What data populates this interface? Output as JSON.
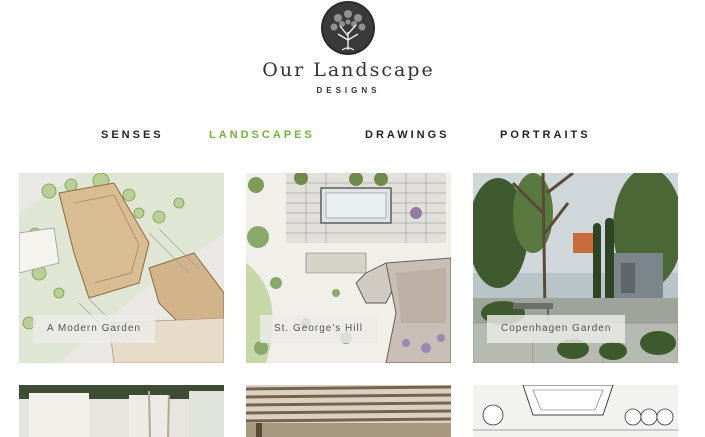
{
  "brand": {
    "title": "Our Landscape",
    "subtitle": "DESIGNS"
  },
  "nav": {
    "items": [
      {
        "label": "SENSES",
        "active": false
      },
      {
        "label": "LANDSCAPES",
        "active": true
      },
      {
        "label": "DRAWINGS",
        "active": false
      },
      {
        "label": "PORTRAITS",
        "active": false
      }
    ],
    "active_color": "#6fb33b"
  },
  "gallery": {
    "tiles": [
      {
        "label": "A Modern Garden"
      },
      {
        "label": "St. George's Hill"
      },
      {
        "label": "Copenhagen Garden"
      }
    ]
  }
}
